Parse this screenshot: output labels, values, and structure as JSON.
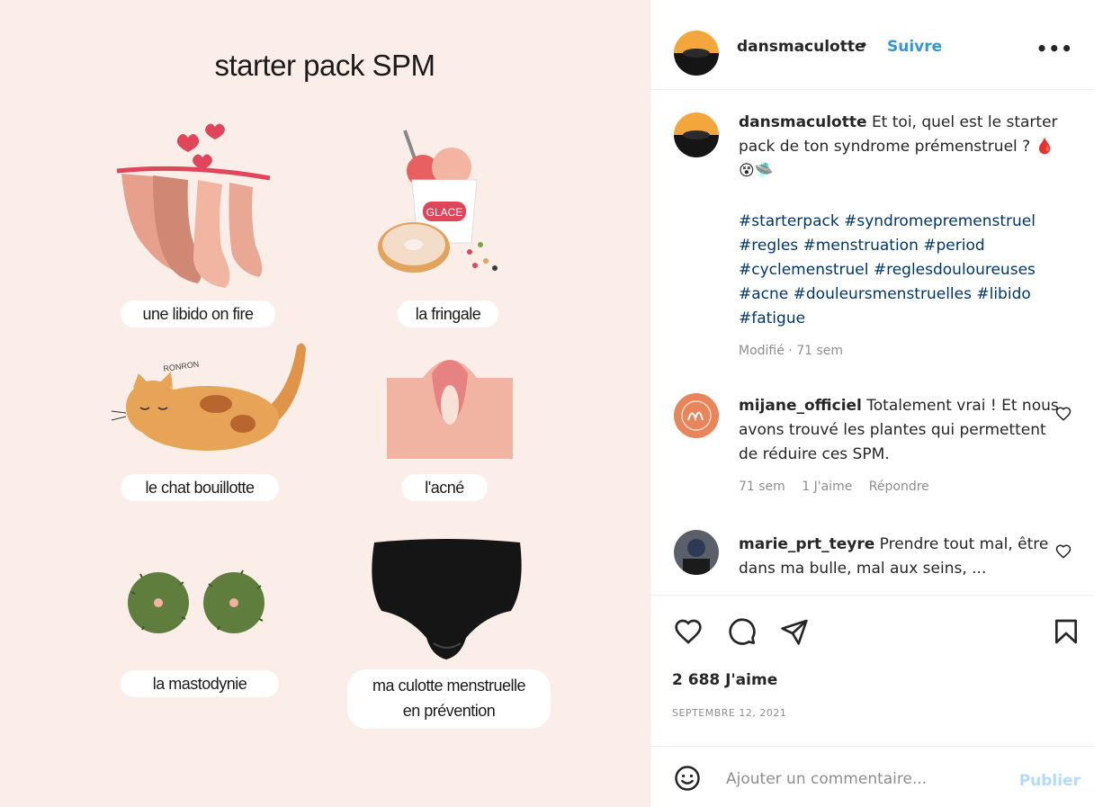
{
  "post_image": {
    "title": "starter pack SPM",
    "items": [
      {
        "label": "une libido on fire"
      },
      {
        "label": "la fringale"
      },
      {
        "label": "le chat bouillotte"
      },
      {
        "label": "l'acné"
      },
      {
        "label": "la mastodynie"
      },
      {
        "label_line1": "ma culotte menstruelle",
        "label_line2": "en prévention"
      }
    ],
    "glace_text": "GLACE",
    "ronron_text": "RONRON"
  },
  "header": {
    "username": "dansmaculotte",
    "separator": "•",
    "follow_label": "Suivre",
    "more_label": "•••"
  },
  "caption": {
    "username": "dansmaculotte",
    "text": "Et toi, quel est le starter pack de ton syndrome prémenstruel ? 🩸😵🛸",
    "hashtags": "#starterpack #syndromepremenstruel #regles #menstruation #period #cyclemenstruel #reglesdouloureuses #acne #douleursmenstruelles #libido #fatigue",
    "meta": "Modifié · 71 sem"
  },
  "comments": [
    {
      "username": "mijane_officiel",
      "text": "Totalement vrai ! Et nous avons trouvé les plantes qui permettent de réduire ces SPM.",
      "time": "71 sem",
      "likes": "1 J'aime",
      "reply": "Répondre"
    },
    {
      "username": "marie_prt_teyre",
      "text": "Prendre tout mal, être dans ma bulle, mal aux seins, ..."
    }
  ],
  "stats": {
    "likes": "2 688 J'aime",
    "date": "SEPTEMBRE 12, 2021"
  },
  "add_comment": {
    "placeholder": "Ajouter un commentaire...",
    "publish_label": "Publier"
  },
  "colors": {
    "accent": "#3796d6",
    "publish_disabled": "#b3dbff",
    "post_bg": "#fbeee9"
  }
}
